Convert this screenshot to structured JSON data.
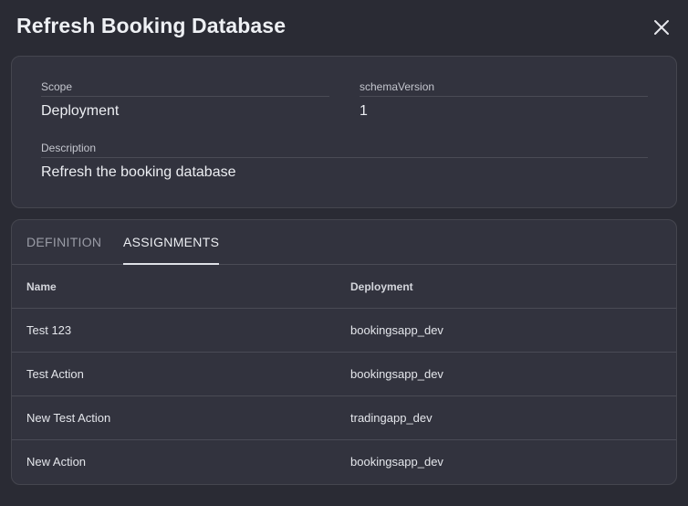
{
  "dialog": {
    "title": "Refresh Booking Database",
    "close_icon": "close-icon"
  },
  "info": {
    "scope_label": "Scope",
    "scope_value": "Deployment",
    "schema_label": "schemaVersion",
    "schema_value": "1",
    "description_label": "Description",
    "description_value": "Refresh the booking database"
  },
  "tabs": [
    {
      "label": "DEFINITION",
      "active": false
    },
    {
      "label": "ASSIGNMENTS",
      "active": true
    }
  ],
  "table": {
    "columns": [
      "Name",
      "Deployment"
    ],
    "rows": [
      [
        "Test 123",
        "bookingsapp_dev"
      ],
      [
        "Test Action",
        "bookingsapp_dev"
      ],
      [
        "New Test Action",
        "tradingapp_dev"
      ],
      [
        "New Action",
        "bookingsapp_dev"
      ]
    ]
  },
  "colors": {
    "background": "#2a2b34",
    "card": "#32333e",
    "divider": "#4a4b55"
  }
}
